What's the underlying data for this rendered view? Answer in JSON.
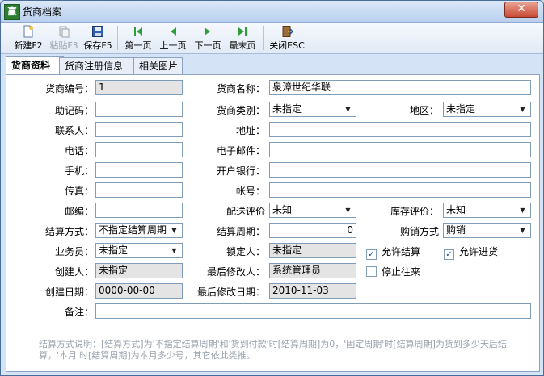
{
  "window": {
    "title": "货商档案",
    "app_icon_text": "赢",
    "close_glyph": "✕"
  },
  "toolbar": {
    "new": "新建F2",
    "paste": "粘贴F3",
    "save": "保存F5",
    "first": "第一页",
    "prev": "上一页",
    "next": "下一页",
    "last": "最末页",
    "close": "关闭ESC"
  },
  "tabs": [
    "货商资料",
    "货商注册信息",
    "相关图片"
  ],
  "form": {
    "code_label": "货商编号：",
    "code_value": "1",
    "name_label": "货商名称：",
    "name_value": "泉漳世纪华联",
    "mnemonic_label": "助记码：",
    "mnemonic_value": "",
    "category_label": "货商类别：",
    "category_value": "未指定",
    "region_label": "地区：",
    "region_value": "未指定",
    "contact_label": "联系人：",
    "contact_value": "",
    "address_label": "地址：",
    "address_value": "",
    "phone_label": "电话：",
    "phone_value": "",
    "email_label": "电子邮件：",
    "email_value": "",
    "mobile_label": "手机：",
    "mobile_value": "",
    "bank_label": "开户银行：",
    "bank_value": "",
    "fax_label": "传真：",
    "fax_value": "",
    "account_label": "帐号：",
    "account_value": "",
    "zip_label": "邮编：",
    "zip_value": "",
    "delivery_rating_label": "配送评价",
    "delivery_rating_value": "未知",
    "stock_rating_label": "库存评价：",
    "stock_rating_value": "未知",
    "settle_method_label": "结算方式：",
    "settle_method_value": "不指定结算周期",
    "settle_period_label": "结算周期：",
    "settle_period_value": "0",
    "purchase_method_label": "购销方式",
    "purchase_method_value": "购销",
    "salesman_label": "业务员：",
    "salesman_value": "未指定",
    "locker_label": "锁定人：",
    "locker_value": "未指定",
    "allow_settle_label": "允许结算",
    "allow_settle_checked": true,
    "allow_purchase_label": "允许进货",
    "allow_purchase_checked": true,
    "creator_label": "创建人：",
    "creator_value": "未指定",
    "modifier_label": "最后修改人：",
    "modifier_value": "系统管理员",
    "stop_label": "停止往来",
    "stop_checked": false,
    "created_label": "创建日期：",
    "created_value": "0000-00-00",
    "modified_label": "最后修改日期：",
    "modified_value": "2010-11-03",
    "remark_label": "备注：",
    "remark_value": ""
  },
  "note": "结算方式说明：[结算方式]为'不指定结算周期'和'货到付款'时[结算周期]为0，'固定周期'时[结算周期]为货到多少天后结算，'本月'时[结算周期]为本月多少号，其它依此类推。",
  "check_glyph": "✓",
  "arrow_glyph": "▼"
}
